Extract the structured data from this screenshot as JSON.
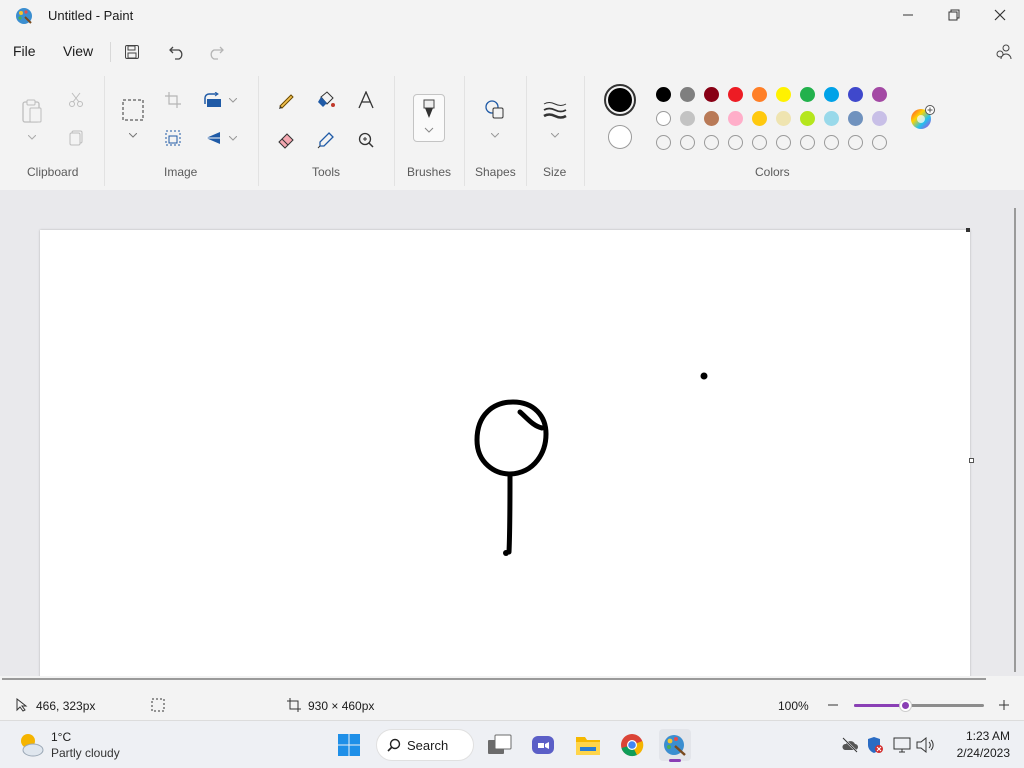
{
  "window": {
    "title": "Untitled - Paint",
    "logo_icon": "paint-palette-icon",
    "controls": [
      "minimize-icon",
      "restore-icon",
      "close-icon"
    ]
  },
  "menu": {
    "file": "File",
    "view": "View",
    "save_icon": "save-icon",
    "undo_icon": "undo-icon",
    "redo_icon": "redo-icon",
    "account_icon": "account-settings-icon"
  },
  "ribbon": {
    "clipboard": {
      "label": "Clipboard",
      "icons": [
        "paste-icon",
        "cut-icon",
        "copy-icon"
      ]
    },
    "image": {
      "label": "Image",
      "icons": [
        "select-icon",
        "crop-icon",
        "rotate-icon",
        "resize-icon",
        "flip-icon"
      ]
    },
    "tools": {
      "label": "Tools",
      "icons": [
        "pencil-icon",
        "fill-icon",
        "text-icon",
        "eraser-icon",
        "color-picker-icon",
        "magnifier-icon"
      ]
    },
    "brushes": {
      "label": "Brushes",
      "icon": "brush-icon"
    },
    "shapes": {
      "label": "Shapes",
      "icon": "shapes-icon"
    },
    "size": {
      "label": "Size",
      "icon": "stroke-size-icon"
    },
    "colors": {
      "label": "Colors",
      "primary": "#000000",
      "secondary": "#ffffff",
      "row1": [
        "#000000",
        "#7f7f7f",
        "#880015",
        "#ed1c24",
        "#ff7f27",
        "#fff200",
        "#22b14c",
        "#00a2e8",
        "#3f48cc",
        "#a349a4"
      ],
      "row2": [
        "#ffffff",
        "#c3c3c3",
        "#b97a57",
        "#ffaec9",
        "#ffc90e",
        "#efe4b0",
        "#b5e61d",
        "#99d9ea",
        "#7092be",
        "#c8bfe7"
      ],
      "row3_empty_count": 10,
      "edit_icon": "edit-colors-icon"
    }
  },
  "canvas": {
    "drawing": "lollipop-stroke"
  },
  "status": {
    "cursor_icon": "cursor-position-icon",
    "cursor_position": "466, 323px",
    "selection_icon": "selection-size-icon",
    "canvas_icon": "canvas-size-icon",
    "canvas_size": "930 × 460px",
    "zoom": "100%",
    "zoom_slider_fraction": 0.39,
    "zoom_out_icon": "zoom-out-icon",
    "zoom_in_icon": "zoom-in-icon",
    "accent": "#8a3fb5"
  },
  "taskbar": {
    "weather_temp": "1°C",
    "weather_desc": "Partly cloudy",
    "search_label": "Search",
    "apps": [
      "start-icon",
      "task-view-icon",
      "teams-chat-icon",
      "file-explorer-icon",
      "chrome-icon",
      "paint-app-icon"
    ],
    "tray": [
      "cloud-offline-icon",
      "security-icon",
      "network-icon",
      "volume-icon"
    ],
    "time": "1:23 AM",
    "date": "2/24/2023"
  }
}
